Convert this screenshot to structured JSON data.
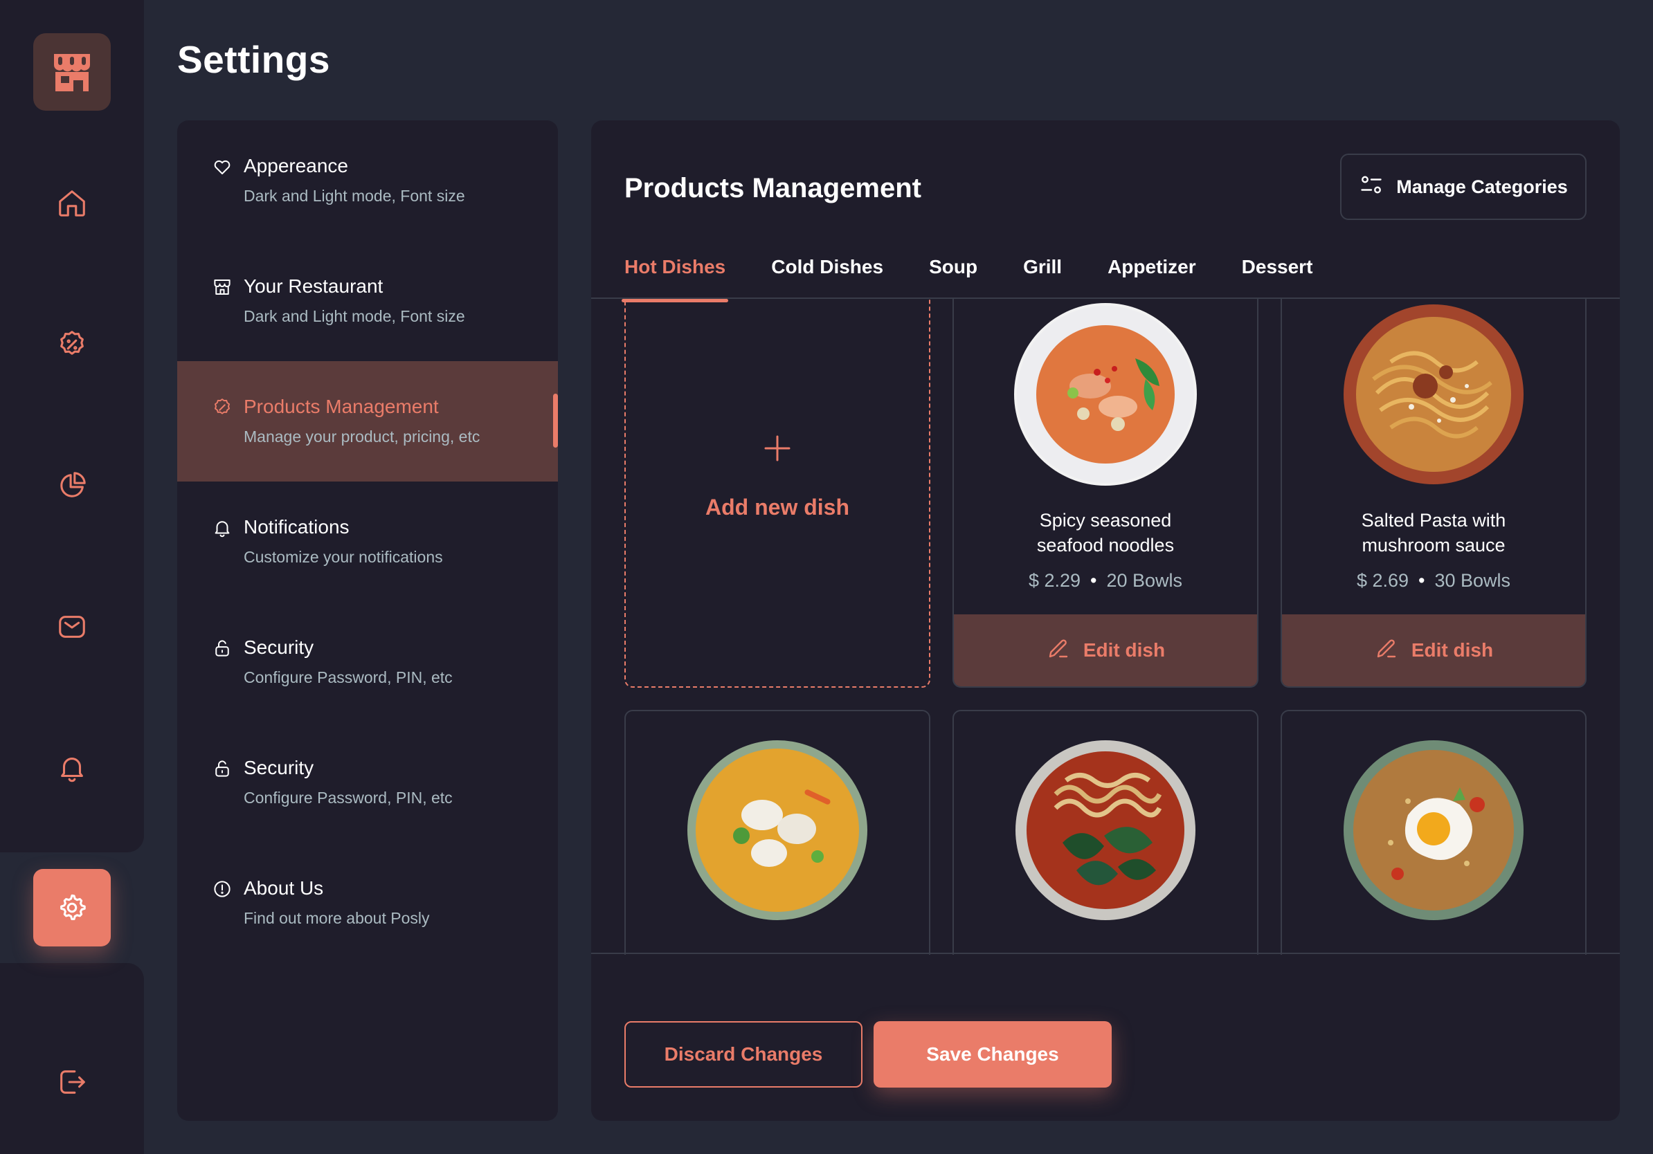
{
  "app": {
    "accent": "#EA7C69",
    "background": "#252836",
    "surface": "#1F1D2B"
  },
  "rail": {
    "items": [
      {
        "icon": "home-icon"
      },
      {
        "icon": "discount-icon"
      },
      {
        "icon": "pie-chart-icon"
      },
      {
        "icon": "mail-icon"
      },
      {
        "icon": "bell-icon"
      },
      {
        "icon": "gear-icon",
        "active": true
      },
      {
        "icon": "logout-icon"
      }
    ]
  },
  "page": {
    "title": "Settings"
  },
  "menu": {
    "items": [
      {
        "title": "Appereance",
        "subtitle": "Dark and Light mode, Font size",
        "icon": "heart-icon"
      },
      {
        "title": "Your Restaurant",
        "subtitle": "Dark and Light mode, Font size",
        "icon": "store-icon"
      },
      {
        "title": "Products Management",
        "subtitle": "Manage your product, pricing, etc",
        "icon": "discount-icon",
        "active": true
      },
      {
        "title": "Notifications",
        "subtitle": "Customize your notifications",
        "icon": "bell-icon"
      },
      {
        "title": "Security",
        "subtitle": "Configure Password, PIN, etc",
        "icon": "lock-icon"
      },
      {
        "title": "Security",
        "subtitle": "Configure Password, PIN, etc",
        "icon": "lock-icon"
      },
      {
        "title": "About Us",
        "subtitle": "Find out more about Posly",
        "icon": "info-icon"
      }
    ]
  },
  "products": {
    "title": "Products Management",
    "manage_categories_label": "Manage Categories",
    "tabs": [
      "Hot Dishes",
      "Cold Dishes",
      "Soup",
      "Grill",
      "Appetizer",
      "Dessert"
    ],
    "active_tab": "Hot Dishes",
    "add_label": "Add new dish",
    "dishes": [
      {
        "name_line1": "Spicy seasoned",
        "name_line2": "seafood noodles",
        "price": "$ 2.29",
        "stock": "20 Bowls",
        "edit_label": "Edit dish"
      },
      {
        "name_line1": "Salted Pasta with",
        "name_line2": "mushroom sauce",
        "price": "$ 2.69",
        "stock": "30 Bowls",
        "edit_label": "Edit dish"
      }
    ],
    "partial_dishes": [
      {
        "image": "dumpling-soup"
      },
      {
        "image": "ramen-greens"
      },
      {
        "image": "fried-rice-egg"
      }
    ],
    "discard_label": "Discard Changes",
    "save_label": "Save Changes"
  }
}
